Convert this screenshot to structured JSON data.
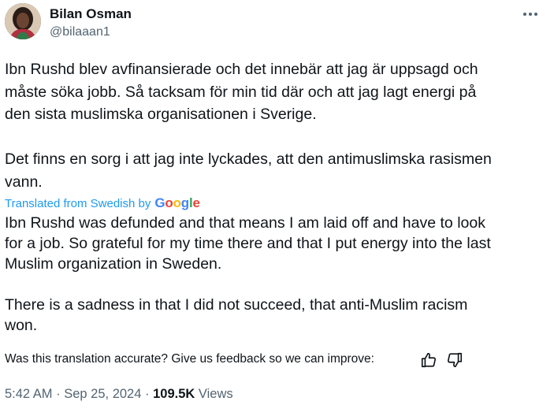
{
  "author": {
    "name": "Bilan Osman",
    "handle": "@bilaaan1"
  },
  "tweet": {
    "original_text": "Ibn Rushd blev avfinansierade och det innebär att jag är uppsagd och\nmåste söka jobb. Så tacksam för min tid där och att jag lagt energi på\nden sista muslimska organisationen i Sverige.\n\nDet finns en sorg i att jag inte lyckades, att den antimuslimska rasismen\nvann.",
    "translated_label": "Translated from Swedish by",
    "google_letters": [
      "G",
      "o",
      "o",
      "g",
      "l",
      "e"
    ],
    "translated_text": "Ibn Rushd was defunded and that means I am laid off and have to look\nfor a job. So grateful for my time there and that I put energy into the last\nMuslim organization in Sweden.\n\nThere is a sadness in that I did not succeed, that anti-Muslim racism\nwon.",
    "feedback_prompt": "Was this translation accurate? Give us feedback so we can improve:"
  },
  "meta": {
    "time": "5:42 AM",
    "date": "Sep 25, 2024",
    "views_count": "109.5K",
    "views_label": "Views",
    "separator": "·"
  },
  "icons": {
    "more": "more-horizontal-icon",
    "thumbs_up": "thumbs-up-icon",
    "thumbs_down": "thumbs-down-icon"
  },
  "colors": {
    "text": "#0f1419",
    "secondary": "#536471",
    "link": "#1d9bf0"
  }
}
